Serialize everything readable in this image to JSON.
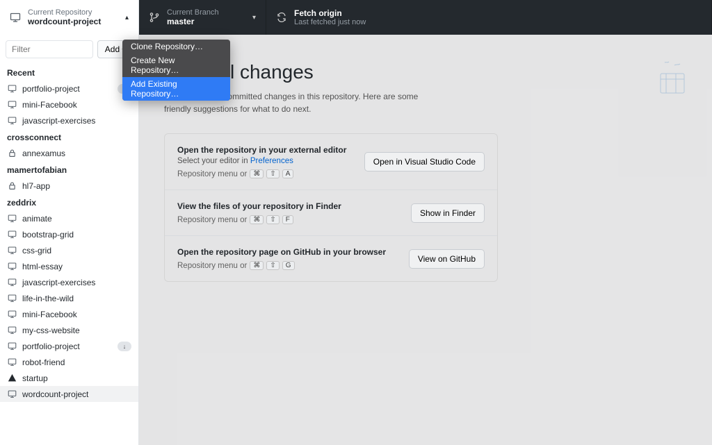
{
  "toolbar": {
    "repo": {
      "label": "Current Repository",
      "value": "wordcount-project"
    },
    "branch": {
      "label": "Current Branch",
      "value": "master"
    },
    "fetch": {
      "label": "Fetch origin",
      "value": "Last fetched just now"
    }
  },
  "sidebar": {
    "filter_placeholder": "Filter",
    "add_label": "Add",
    "sections": {
      "recent": "Recent",
      "crossconnect": "crossconnect",
      "mamertofabian": "mamertofabian",
      "zeddrix": "zeddrix"
    },
    "recent": [
      {
        "name": "portfolio-project",
        "icon": "screen",
        "badge": "down"
      },
      {
        "name": "mini-Facebook",
        "icon": "screen"
      },
      {
        "name": "javascript-exercises",
        "icon": "screen"
      }
    ],
    "crossconnect": [
      {
        "name": "annexamus",
        "icon": "lock",
        "badge": "dot"
      }
    ],
    "mamertofabian": [
      {
        "name": "hl7-app",
        "icon": "lock"
      }
    ],
    "zeddrix": [
      {
        "name": "animate",
        "icon": "screen"
      },
      {
        "name": "bootstrap-grid",
        "icon": "screen"
      },
      {
        "name": "css-grid",
        "icon": "screen"
      },
      {
        "name": "html-essay",
        "icon": "screen"
      },
      {
        "name": "javascript-exercises",
        "icon": "screen"
      },
      {
        "name": "life-in-the-wild",
        "icon": "screen"
      },
      {
        "name": "mini-Facebook",
        "icon": "screen"
      },
      {
        "name": "my-css-website",
        "icon": "screen"
      },
      {
        "name": "portfolio-project",
        "icon": "screen",
        "badge": "down"
      },
      {
        "name": "robot-friend",
        "icon": "screen"
      },
      {
        "name": "startup",
        "icon": "warn"
      },
      {
        "name": "wordcount-project",
        "icon": "screen",
        "selected": true
      }
    ]
  },
  "dropdown": [
    "Clone Repository…",
    "Create New Repository…",
    "Add Existing Repository…"
  ],
  "main": {
    "title": "No local changes",
    "subtitle": "There are no uncommitted changes in this repository. Here are some friendly suggestions for what to do next.",
    "cards": [
      {
        "title": "Open the repository in your external editor",
        "sub_pre": "Select your editor in ",
        "sub_link": "Preferences",
        "shortcut_pre": "Repository menu or",
        "keys": [
          "⌘",
          "⇧",
          "A"
        ],
        "button": "Open in Visual Studio Code"
      },
      {
        "title": "View the files of your repository in Finder",
        "shortcut_pre": "Repository menu or",
        "keys": [
          "⌘",
          "⇧",
          "F"
        ],
        "button": "Show in Finder"
      },
      {
        "title": "Open the repository page on GitHub in your browser",
        "shortcut_pre": "Repository menu or",
        "keys": [
          "⌘",
          "⇧",
          "G"
        ],
        "button": "View on GitHub"
      }
    ]
  }
}
